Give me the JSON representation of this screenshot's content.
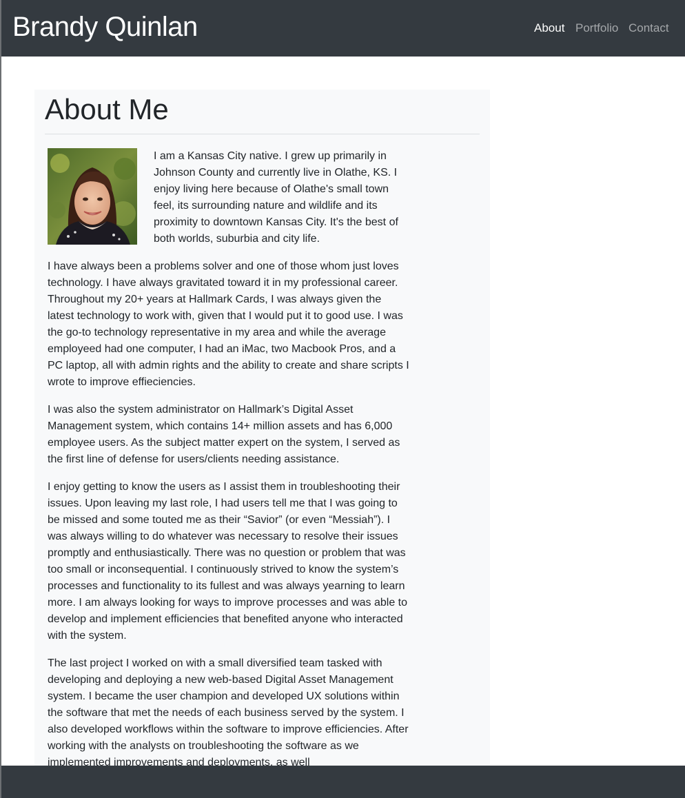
{
  "navbar": {
    "brand": "Brandy Quinlan",
    "links": [
      {
        "label": "About",
        "active": true
      },
      {
        "label": "Portfolio",
        "active": false
      },
      {
        "label": "Contact",
        "active": false
      }
    ]
  },
  "about": {
    "title": "About Me",
    "intro": "I am a Kansas City native. I grew up primarily in Johnson County and currently live in Olathe, KS. I enjoy living here because of Olathe's small town feel, its surrounding nature and wildlife and its proximity to downtown Kansas City. It's the best of both worlds, suburbia and city life.",
    "paragraphs": [
      "I have always been a problems solver and one of those whom just loves technology. I have always gravitated toward it in my professional career. Throughout my 20+ years at Hallmark Cards, I was always given the latest technology to work with, given that I would put it to good use. I was the go-to technology representative in my area and while the average employeed had one computer, I had an iMac, two Macbook Pros, and a PC laptop, all with admin rights and the ability to create and share scripts I wrote to improve effieciencies.",
      "I was also the system administrator on Hallmark’s Digital Asset Management system, which contains 14+ million assets and has 6,000 employee users. As the subject matter expert on the system, I served as the first line of defense for users/clients needing assistance.",
      "I enjoy getting to know the users as I assist them in troubleshooting their issues. Upon leaving my last role, I had users tell me that I was going to be missed and some touted me as their “Savior” (or even “Messiah”). I was always willing to do whatever was necessary to resolve their issues promptly and enthusiastically. There was no question or problem that was too small or inconsequential. I continuously strived to know the system’s processes and functionality to its fullest and was always yearning to learn more. I am always looking for ways to improve processes and was able to develop and implement efficiencies that benefited anyone who interacted with the system.",
      "The last project I worked on with a small diversified team tasked with developing and deploying a new web-based Digital Asset Management system. I became the user champion and developed UX solutions within the software that met the needs of each business served by the system. I also developed workflows within the software to improve efficiencies. After working with the analysts on troubleshooting the software as we implemented improvements and deployments, as well"
    ]
  },
  "colors": {
    "navbar_bg": "#343a40",
    "content_bg": "#f8f9fa",
    "text": "#212529",
    "nav_inactive": "#9a9da0"
  }
}
